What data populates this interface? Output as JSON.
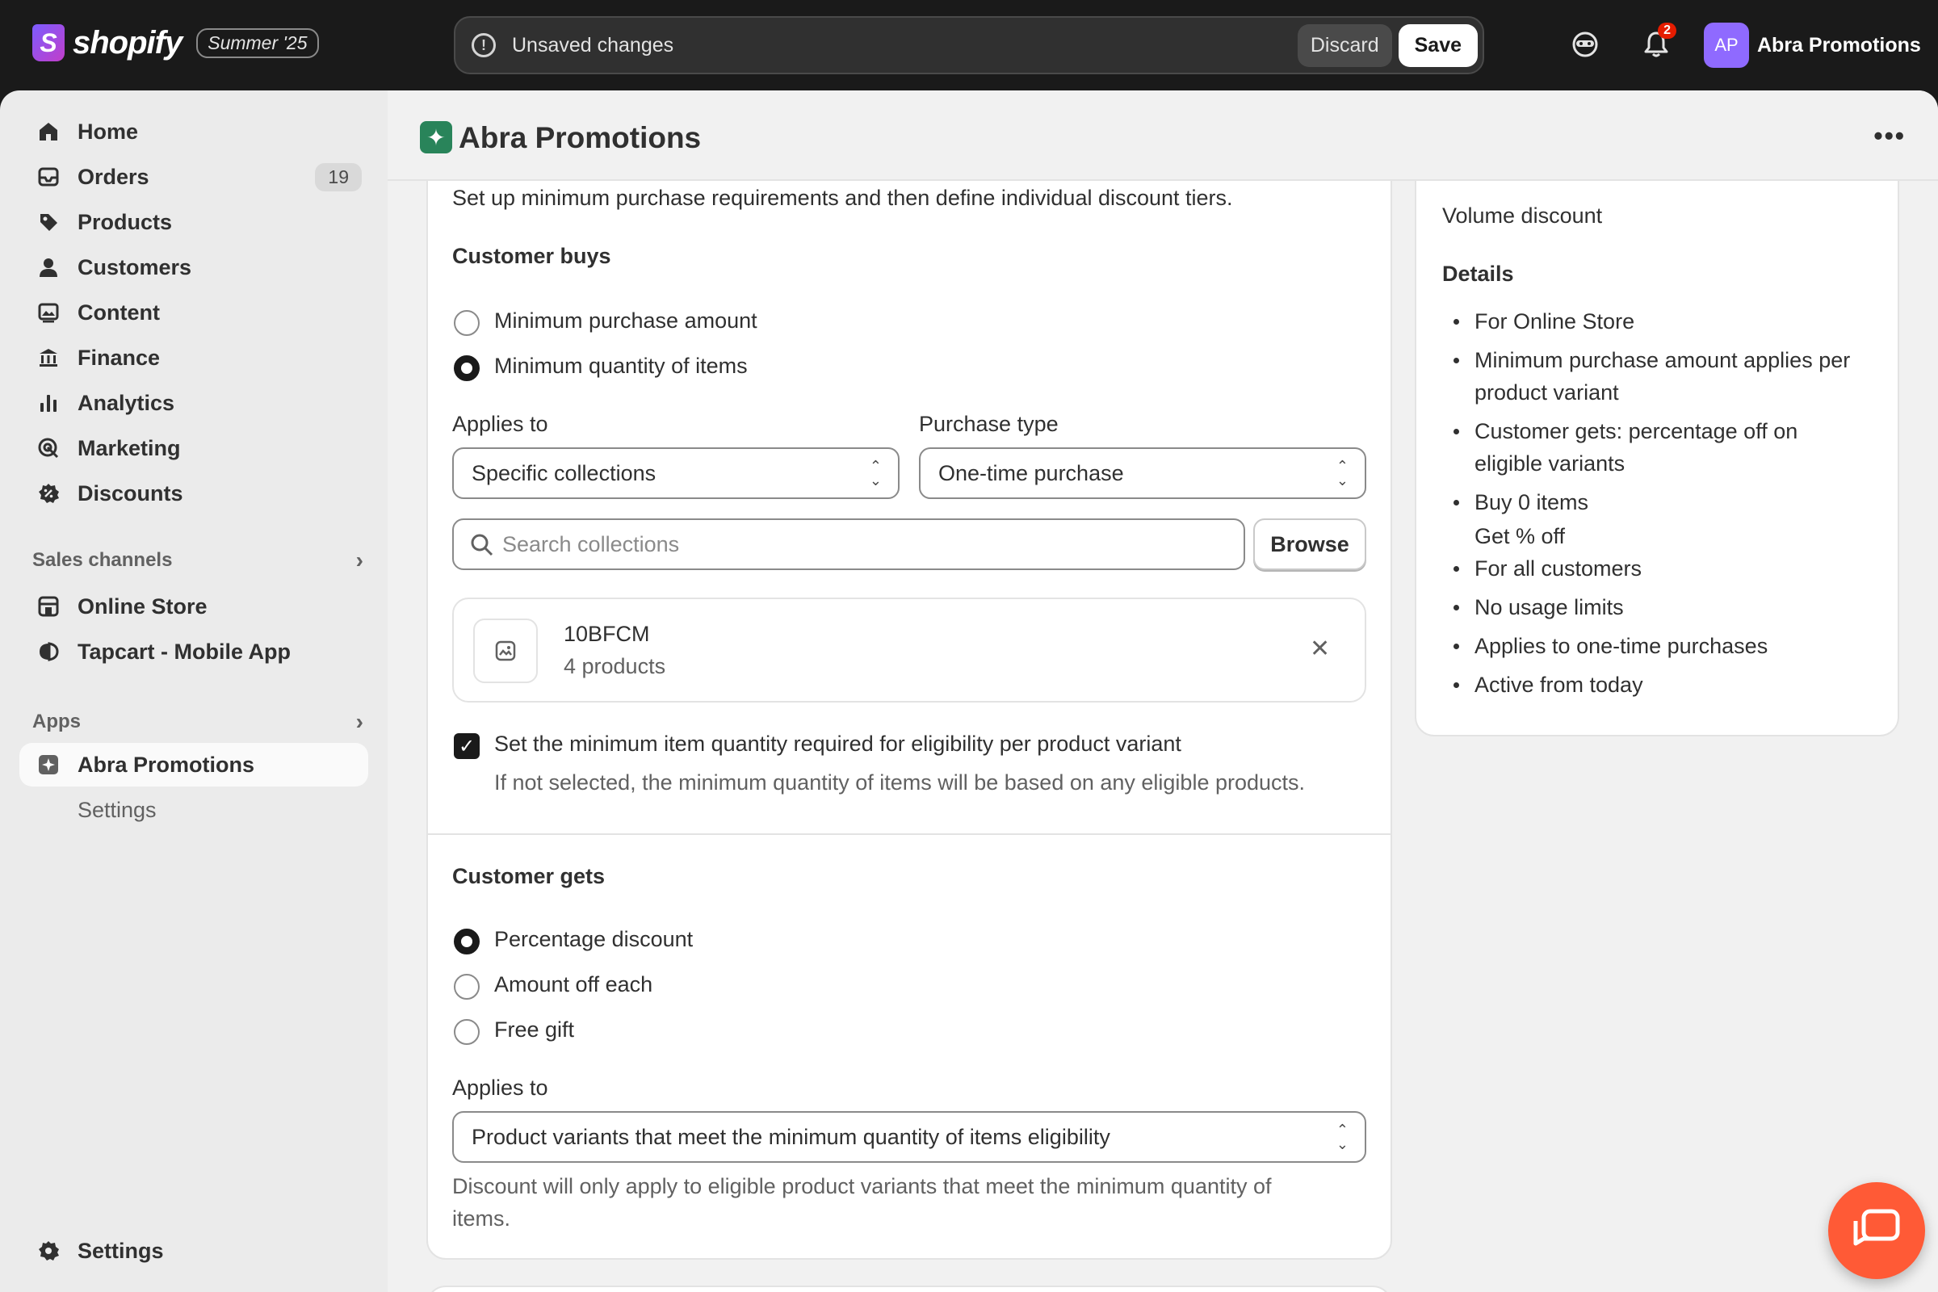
{
  "topbar": {
    "brand": "shopify",
    "edition": "Summer '25",
    "savebar_message": "Unsaved changes",
    "discard_label": "Discard",
    "save_label": "Save",
    "notification_count": "2",
    "avatar_initials": "AP",
    "store_name": "Abra Promotions"
  },
  "sidebar": {
    "items": [
      {
        "label": "Home",
        "icon": "home-icon"
      },
      {
        "label": "Orders",
        "icon": "orders-icon",
        "badge": "19"
      },
      {
        "label": "Products",
        "icon": "tag-icon"
      },
      {
        "label": "Customers",
        "icon": "person-icon"
      },
      {
        "label": "Content",
        "icon": "content-icon"
      },
      {
        "label": "Finance",
        "icon": "bank-icon"
      },
      {
        "label": "Analytics",
        "icon": "bar-chart-icon"
      },
      {
        "label": "Marketing",
        "icon": "target-icon"
      },
      {
        "label": "Discounts",
        "icon": "discount-icon"
      }
    ],
    "sales_channels_heading": "Sales channels",
    "channels": [
      {
        "label": "Online Store",
        "icon": "store-icon"
      },
      {
        "label": "Tapcart - Mobile App",
        "icon": "tapcart-icon"
      }
    ],
    "apps_heading": "Apps",
    "apps": [
      {
        "label": "Abra Promotions",
        "icon": "abra-app-icon"
      },
      {
        "label": "Settings"
      }
    ],
    "settings_label": "Settings"
  },
  "page": {
    "title": "Abra Promotions",
    "more_label": "•••"
  },
  "form": {
    "intro": "Set up minimum purchase requirements and then define individual discount tiers.",
    "customer_buys_heading": "Customer buys",
    "buys_options": [
      {
        "label": "Minimum purchase amount",
        "selected": false
      },
      {
        "label": "Minimum quantity of items",
        "selected": true
      }
    ],
    "applies_to_label": "Applies to",
    "applies_to_value": "Specific collections",
    "purchase_type_label": "Purchase type",
    "purchase_type_value": "One-time purchase",
    "search_placeholder": "Search collections",
    "browse_label": "Browse",
    "collection": {
      "name": "10BFCM",
      "count": "4 products"
    },
    "variant_checkbox_label": "Set the minimum item quantity required for eligibility per product variant",
    "variant_checkbox_help": "If not selected, the minimum quantity of items will be based on any eligible products.",
    "customer_gets_heading": "Customer gets",
    "gets_options": [
      {
        "label": "Percentage discount",
        "selected": true
      },
      {
        "label": "Amount off each",
        "selected": false
      },
      {
        "label": "Free gift",
        "selected": false
      }
    ],
    "gets_applies_label": "Applies to",
    "gets_applies_value": "Product variants that meet the minimum quantity of items eligibility",
    "gets_help_line1": "Discount will only apply to eligible product variants that meet the minimum quantity of",
    "gets_help_line2": "items."
  },
  "summary": {
    "type": "Volume discount",
    "details_heading": "Details",
    "details": [
      "For Online Store",
      "Minimum purchase amount applies per",
      "product variant",
      "Customer gets: percentage off on",
      "eligible variants",
      "Buy 0 items",
      "Get % off",
      "For all customers",
      "No usage limits",
      "Applies to one-time purchases",
      "Active from today"
    ]
  },
  "colors": {
    "topbar_bg": "#1a1a1a",
    "sidebar_bg": "#ebebeb",
    "main_bg": "#f1f1f1",
    "app_badge": "#29845a",
    "avatar": "#8f6aff",
    "chat_fab": "#ff5a36",
    "notification_badge": "#e51c00"
  }
}
